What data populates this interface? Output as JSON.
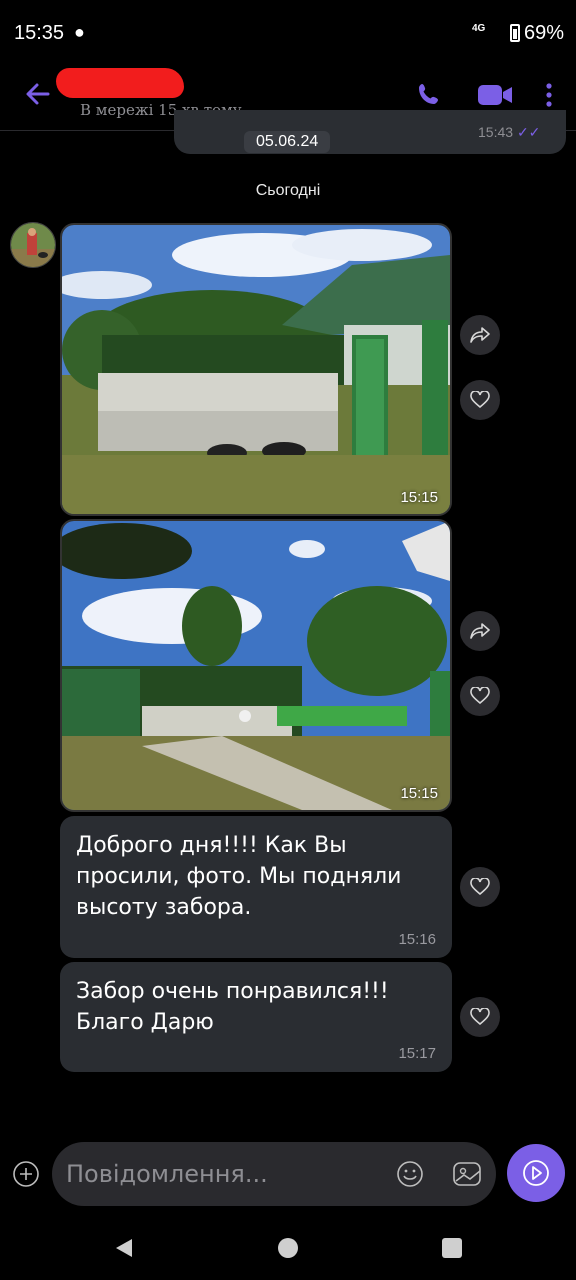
{
  "status_bar": {
    "time": "15:35",
    "network": "4G",
    "battery": "69%"
  },
  "header": {
    "presence": "В мережі 15 хв тому"
  },
  "previous_message": {
    "date": "05.06.24",
    "time": "15:43"
  },
  "day_separator": "Сьогодні",
  "messages": [
    {
      "type": "photo",
      "time": "15:15"
    },
    {
      "type": "photo",
      "time": "15:15"
    },
    {
      "type": "text",
      "text": "Доброго дня!!!! Как Вы просили, фото. Мы подняли высоту забора.",
      "time": "15:16"
    },
    {
      "type": "text",
      "text": "Забор очень понравился!!! Благо Дарю",
      "time": "15:17"
    }
  ],
  "composer": {
    "placeholder": "Повідомлення..."
  },
  "colors": {
    "accent": "#7b5fe6",
    "bubble": "#2a2d32",
    "background": "#000000"
  },
  "icons": [
    "back-arrow-icon",
    "phone-icon",
    "video-icon",
    "more-icon",
    "share-icon",
    "heart-icon",
    "plus-icon",
    "emoji-icon",
    "sticker-icon",
    "send-icon"
  ]
}
